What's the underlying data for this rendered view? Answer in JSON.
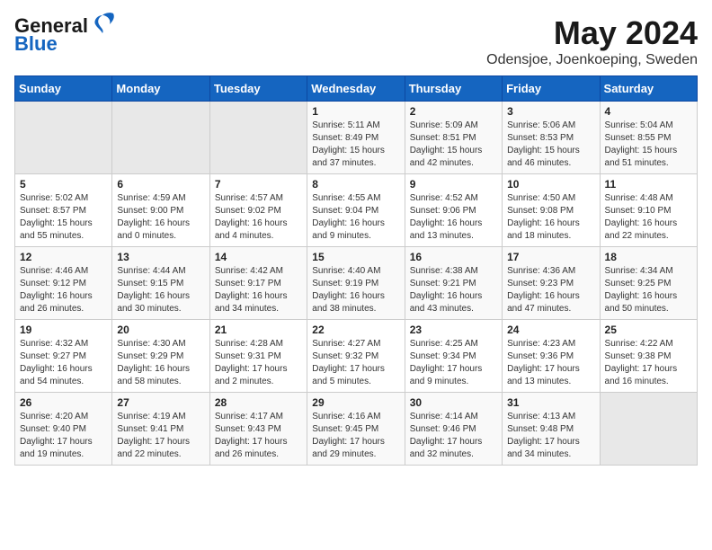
{
  "header": {
    "logo_general": "General",
    "logo_blue": "Blue",
    "month_title": "May 2024",
    "location": "Odensjoe, Joenkoeping, Sweden"
  },
  "days_of_week": [
    "Sunday",
    "Monday",
    "Tuesday",
    "Wednesday",
    "Thursday",
    "Friday",
    "Saturday"
  ],
  "weeks": [
    [
      {
        "day": "",
        "detail": ""
      },
      {
        "day": "",
        "detail": ""
      },
      {
        "day": "",
        "detail": ""
      },
      {
        "day": "1",
        "detail": "Sunrise: 5:11 AM\nSunset: 8:49 PM\nDaylight: 15 hours\nand 37 minutes."
      },
      {
        "day": "2",
        "detail": "Sunrise: 5:09 AM\nSunset: 8:51 PM\nDaylight: 15 hours\nand 42 minutes."
      },
      {
        "day": "3",
        "detail": "Sunrise: 5:06 AM\nSunset: 8:53 PM\nDaylight: 15 hours\nand 46 minutes."
      },
      {
        "day": "4",
        "detail": "Sunrise: 5:04 AM\nSunset: 8:55 PM\nDaylight: 15 hours\nand 51 minutes."
      }
    ],
    [
      {
        "day": "5",
        "detail": "Sunrise: 5:02 AM\nSunset: 8:57 PM\nDaylight: 15 hours\nand 55 minutes."
      },
      {
        "day": "6",
        "detail": "Sunrise: 4:59 AM\nSunset: 9:00 PM\nDaylight: 16 hours\nand 0 minutes."
      },
      {
        "day": "7",
        "detail": "Sunrise: 4:57 AM\nSunset: 9:02 PM\nDaylight: 16 hours\nand 4 minutes."
      },
      {
        "day": "8",
        "detail": "Sunrise: 4:55 AM\nSunset: 9:04 PM\nDaylight: 16 hours\nand 9 minutes."
      },
      {
        "day": "9",
        "detail": "Sunrise: 4:52 AM\nSunset: 9:06 PM\nDaylight: 16 hours\nand 13 minutes."
      },
      {
        "day": "10",
        "detail": "Sunrise: 4:50 AM\nSunset: 9:08 PM\nDaylight: 16 hours\nand 18 minutes."
      },
      {
        "day": "11",
        "detail": "Sunrise: 4:48 AM\nSunset: 9:10 PM\nDaylight: 16 hours\nand 22 minutes."
      }
    ],
    [
      {
        "day": "12",
        "detail": "Sunrise: 4:46 AM\nSunset: 9:12 PM\nDaylight: 16 hours\nand 26 minutes."
      },
      {
        "day": "13",
        "detail": "Sunrise: 4:44 AM\nSunset: 9:15 PM\nDaylight: 16 hours\nand 30 minutes."
      },
      {
        "day": "14",
        "detail": "Sunrise: 4:42 AM\nSunset: 9:17 PM\nDaylight: 16 hours\nand 34 minutes."
      },
      {
        "day": "15",
        "detail": "Sunrise: 4:40 AM\nSunset: 9:19 PM\nDaylight: 16 hours\nand 38 minutes."
      },
      {
        "day": "16",
        "detail": "Sunrise: 4:38 AM\nSunset: 9:21 PM\nDaylight: 16 hours\nand 43 minutes."
      },
      {
        "day": "17",
        "detail": "Sunrise: 4:36 AM\nSunset: 9:23 PM\nDaylight: 16 hours\nand 47 minutes."
      },
      {
        "day": "18",
        "detail": "Sunrise: 4:34 AM\nSunset: 9:25 PM\nDaylight: 16 hours\nand 50 minutes."
      }
    ],
    [
      {
        "day": "19",
        "detail": "Sunrise: 4:32 AM\nSunset: 9:27 PM\nDaylight: 16 hours\nand 54 minutes."
      },
      {
        "day": "20",
        "detail": "Sunrise: 4:30 AM\nSunset: 9:29 PM\nDaylight: 16 hours\nand 58 minutes."
      },
      {
        "day": "21",
        "detail": "Sunrise: 4:28 AM\nSunset: 9:31 PM\nDaylight: 17 hours\nand 2 minutes."
      },
      {
        "day": "22",
        "detail": "Sunrise: 4:27 AM\nSunset: 9:32 PM\nDaylight: 17 hours\nand 5 minutes."
      },
      {
        "day": "23",
        "detail": "Sunrise: 4:25 AM\nSunset: 9:34 PM\nDaylight: 17 hours\nand 9 minutes."
      },
      {
        "day": "24",
        "detail": "Sunrise: 4:23 AM\nSunset: 9:36 PM\nDaylight: 17 hours\nand 13 minutes."
      },
      {
        "day": "25",
        "detail": "Sunrise: 4:22 AM\nSunset: 9:38 PM\nDaylight: 17 hours\nand 16 minutes."
      }
    ],
    [
      {
        "day": "26",
        "detail": "Sunrise: 4:20 AM\nSunset: 9:40 PM\nDaylight: 17 hours\nand 19 minutes."
      },
      {
        "day": "27",
        "detail": "Sunrise: 4:19 AM\nSunset: 9:41 PM\nDaylight: 17 hours\nand 22 minutes."
      },
      {
        "day": "28",
        "detail": "Sunrise: 4:17 AM\nSunset: 9:43 PM\nDaylight: 17 hours\nand 26 minutes."
      },
      {
        "day": "29",
        "detail": "Sunrise: 4:16 AM\nSunset: 9:45 PM\nDaylight: 17 hours\nand 29 minutes."
      },
      {
        "day": "30",
        "detail": "Sunrise: 4:14 AM\nSunset: 9:46 PM\nDaylight: 17 hours\nand 32 minutes."
      },
      {
        "day": "31",
        "detail": "Sunrise: 4:13 AM\nSunset: 9:48 PM\nDaylight: 17 hours\nand 34 minutes."
      },
      {
        "day": "",
        "detail": ""
      }
    ]
  ]
}
